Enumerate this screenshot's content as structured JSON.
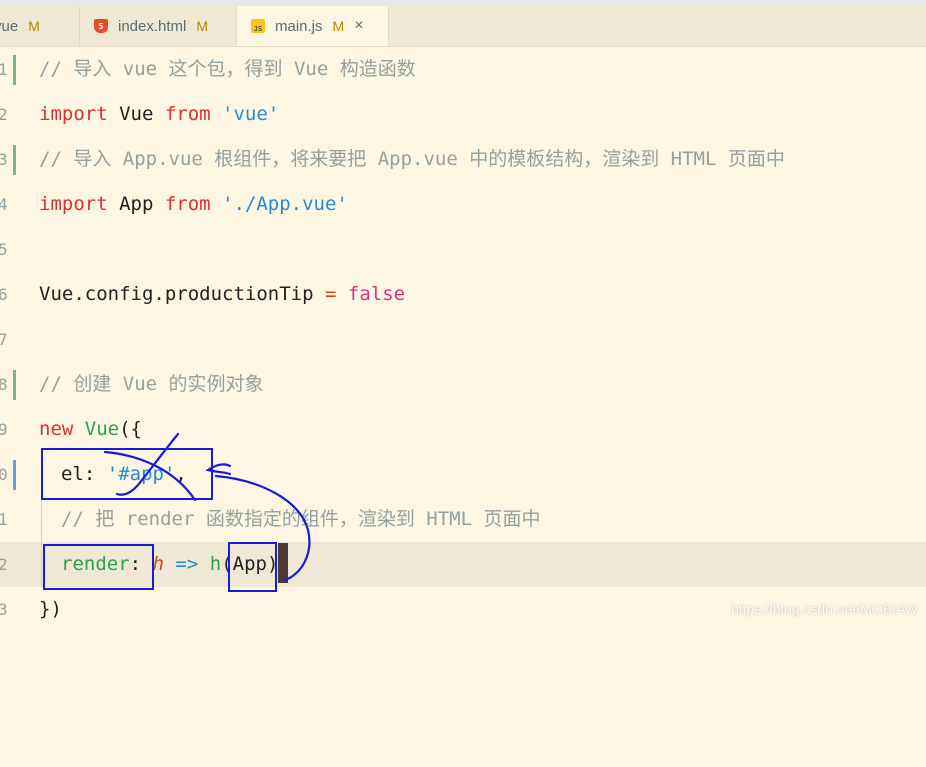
{
  "tabs": [
    {
      "label": "vue",
      "status": "M",
      "icon": "vue-file-icon"
    },
    {
      "label": "index.html",
      "status": "M",
      "icon": "html-file-icon"
    },
    {
      "label": "main.js",
      "status": "M",
      "icon": "js-file-icon",
      "active": true,
      "close": "×"
    }
  ],
  "lines": {
    "l1": {
      "num": "1",
      "comment": "// 导入 vue 这个包，得到 Vue 构造函数"
    },
    "l2": {
      "num": "2",
      "kw": "import",
      "name": " Vue ",
      "from": "from",
      "str": " 'vue'"
    },
    "l3": {
      "num": "3",
      "comment": "// 导入 App.vue 根组件，将来要把 App.vue 中的模板结构，渲染到 HTML 页面中"
    },
    "l4": {
      "num": "4",
      "kw": "import",
      "name": " App ",
      "from": "from",
      "str": " './App.vue'"
    },
    "l5": {
      "num": "5"
    },
    "l6": {
      "num": "6",
      "code": "Vue.config.productionTip ",
      "op": "=",
      "bool": " false"
    },
    "l7": {
      "num": "7"
    },
    "l8": {
      "num": "8",
      "comment": "// 创建 Vue 的实例对象"
    },
    "l9": {
      "num": "9",
      "kw": "new",
      "cls": " Vue",
      "rest": "({"
    },
    "l10": {
      "num": "0",
      "prop": "el:",
      "str": " '#app'",
      "rest": ","
    },
    "l11": {
      "num": "1",
      "comment": "// 把 render 函数指定的组件，渲染到 HTML 页面中"
    },
    "l12": {
      "num": "2",
      "prop": "render",
      "colon": ":",
      "param": " h",
      "arrow": " =>",
      "fn": " h",
      "open": "(",
      "arg": "App",
      "close": ")"
    },
    "l13": {
      "num": "3",
      "rest": "})"
    }
  },
  "watermark": "https://blog.csdn.net/MOEIAW",
  "colors": {
    "background": "#fdf6e3",
    "annotation": "#1a1adb",
    "keyword": "#dc322f",
    "string": "#268bd2"
  }
}
